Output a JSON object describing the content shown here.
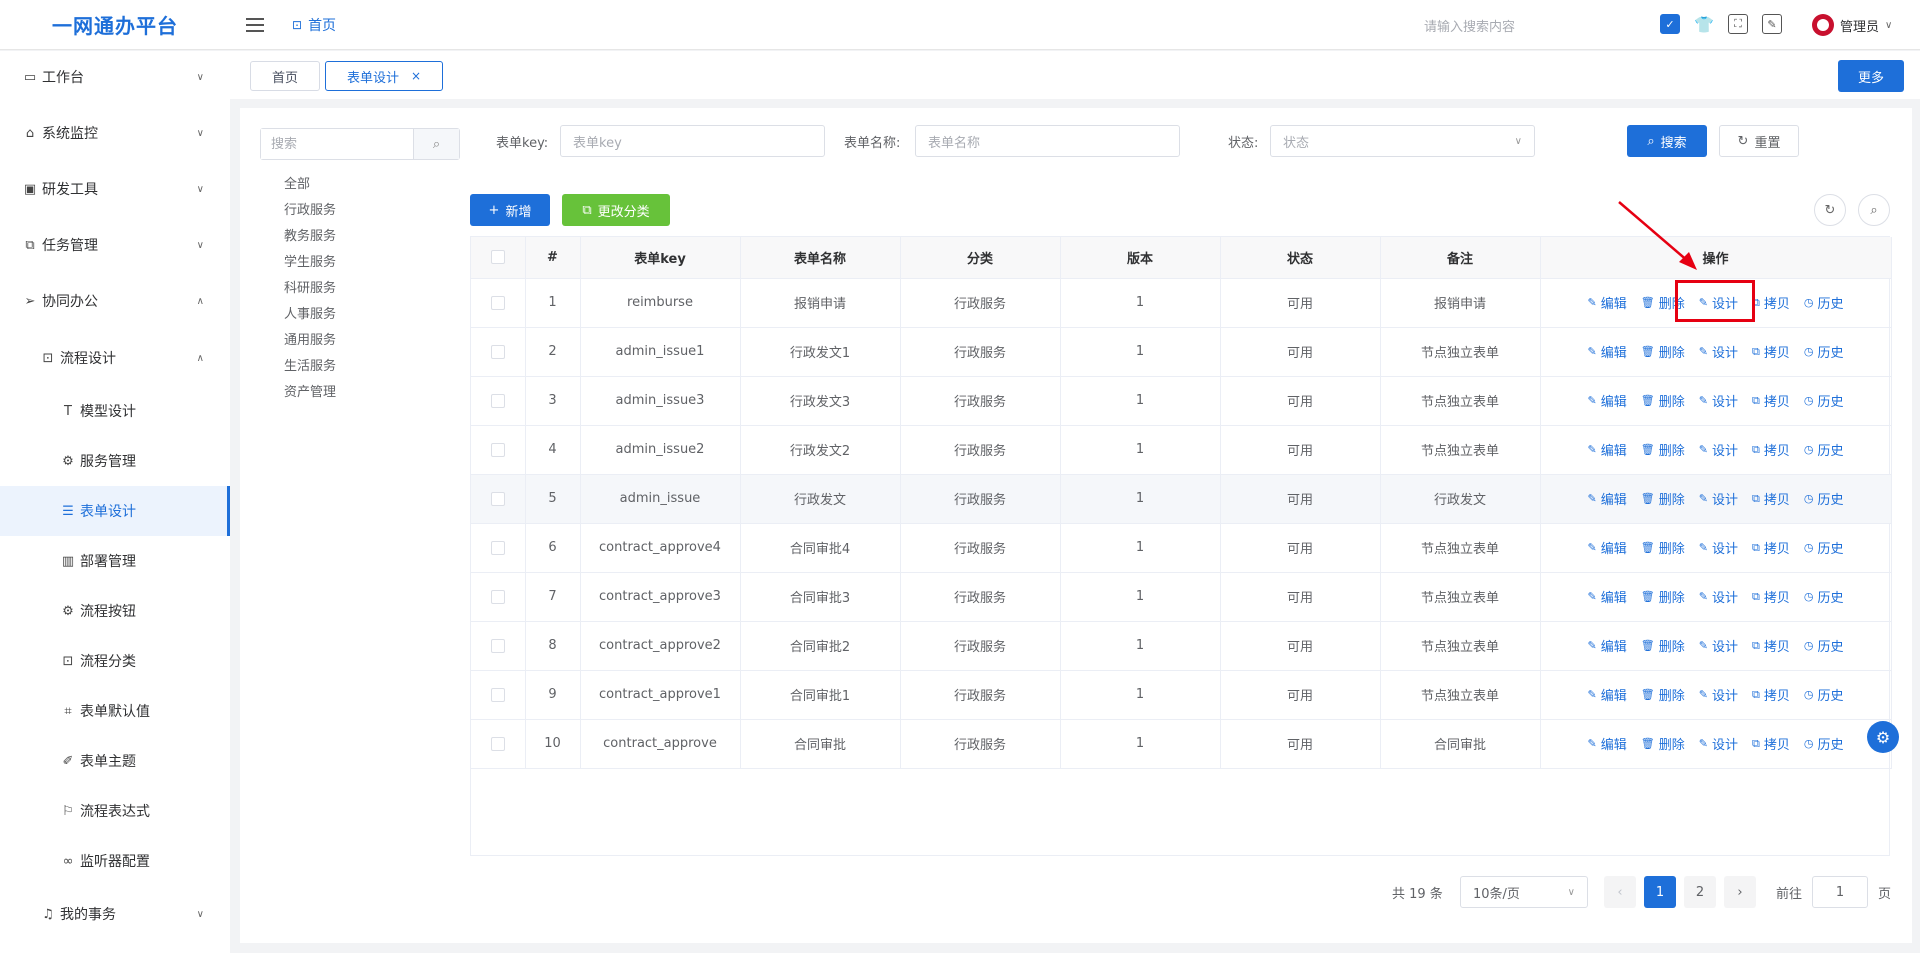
{
  "app": {
    "title": "一网通办平台"
  },
  "header": {
    "breadcrumb": "首页",
    "search_placeholder": "请输入搜索内容",
    "user": "管理员",
    "icons": [
      "checkbox-icon",
      "shirt-icon",
      "fullscreen-icon",
      "tool-icon"
    ]
  },
  "sidebar": {
    "items": [
      {
        "label": "工作台",
        "icon": "monitor-icon"
      },
      {
        "label": "系统监控",
        "icon": "bank-icon"
      },
      {
        "label": "研发工具",
        "icon": "terminal-icon"
      },
      {
        "label": "任务管理",
        "icon": "copy-icon"
      },
      {
        "label": "协同办公",
        "icon": "send-icon"
      },
      {
        "label": "流程设计",
        "icon": "flow-icon"
      },
      {
        "label": "模型设计",
        "icon": "text-icon"
      },
      {
        "label": "服务管理",
        "icon": "gear-icon"
      },
      {
        "label": "表单设计",
        "icon": "form-icon"
      },
      {
        "label": "部署管理",
        "icon": "chart-icon"
      },
      {
        "label": "流程按钮",
        "icon": "gear-icon"
      },
      {
        "label": "流程分类",
        "icon": "flow-icon"
      },
      {
        "label": "表单默认值",
        "icon": "tag-icon"
      },
      {
        "label": "表单主题",
        "icon": "brush-icon"
      },
      {
        "label": "流程表达式",
        "icon": "flag-icon"
      },
      {
        "label": "监听器配置",
        "icon": "link-icon"
      },
      {
        "label": "我的事务",
        "icon": "bell-icon"
      }
    ]
  },
  "tabs": [
    {
      "label": "首页"
    },
    {
      "label": "表单设计",
      "close": "×"
    }
  ],
  "more_button": "更多",
  "tree": {
    "search_placeholder": "搜索",
    "items": [
      "全部",
      "行政服务",
      "教务服务",
      "学生服务",
      "科研服务",
      "人事服务",
      "通用服务",
      "生活服务",
      "资产管理"
    ]
  },
  "filters": {
    "key_label": "表单key:",
    "key_placeholder": "表单key",
    "name_label": "表单名称:",
    "name_placeholder": "表单名称",
    "status_label": "状态:",
    "status_placeholder": "状态",
    "search_button": "搜索",
    "reset_button": "重置"
  },
  "toolbar": {
    "add_button": "新增",
    "change_category_button": "更改分类"
  },
  "table": {
    "headers": [
      "#",
      "表单key",
      "表单名称",
      "分类",
      "版本",
      "状态",
      "备注",
      "操作"
    ],
    "ops": [
      "编辑",
      "删除",
      "设计",
      "拷贝",
      "历史"
    ],
    "rows": [
      {
        "no": "1",
        "key": "reimburse",
        "name": "报销申请",
        "category": "行政服务",
        "version": "1",
        "status": "可用",
        "remark": "报销申请"
      },
      {
        "no": "2",
        "key": "admin_issue1",
        "name": "行政发文1",
        "category": "行政服务",
        "version": "1",
        "status": "可用",
        "remark": "节点独立表单"
      },
      {
        "no": "3",
        "key": "admin_issue3",
        "name": "行政发文3",
        "category": "行政服务",
        "version": "1",
        "status": "可用",
        "remark": "节点独立表单"
      },
      {
        "no": "4",
        "key": "admin_issue2",
        "name": "行政发文2",
        "category": "行政服务",
        "version": "1",
        "status": "可用",
        "remark": "节点独立表单"
      },
      {
        "no": "5",
        "key": "admin_issue",
        "name": "行政发文",
        "category": "行政服务",
        "version": "1",
        "status": "可用",
        "remark": "行政发文"
      },
      {
        "no": "6",
        "key": "contract_approve4",
        "name": "合同审批4",
        "category": "行政服务",
        "version": "1",
        "status": "可用",
        "remark": "节点独立表单"
      },
      {
        "no": "7",
        "key": "contract_approve3",
        "name": "合同审批3",
        "category": "行政服务",
        "version": "1",
        "status": "可用",
        "remark": "节点独立表单"
      },
      {
        "no": "8",
        "key": "contract_approve2",
        "name": "合同审批2",
        "category": "行政服务",
        "version": "1",
        "status": "可用",
        "remark": "节点独立表单"
      },
      {
        "no": "9",
        "key": "contract_approve1",
        "name": "合同审批1",
        "category": "行政服务",
        "version": "1",
        "status": "可用",
        "remark": "节点独立表单"
      },
      {
        "no": "10",
        "key": "contract_approve",
        "name": "合同审批",
        "category": "行政服务",
        "version": "1",
        "status": "可用",
        "remark": "合同审批"
      }
    ]
  },
  "pagination": {
    "total": "共 19 条",
    "page_size": "10条/页",
    "pages": [
      "1",
      "2"
    ],
    "goto_label": "前往",
    "goto_value": "1",
    "page_suffix": "页"
  },
  "colors": {
    "primary": "#1e6fd9",
    "success": "#67c23a",
    "highlight": "#e60012"
  }
}
